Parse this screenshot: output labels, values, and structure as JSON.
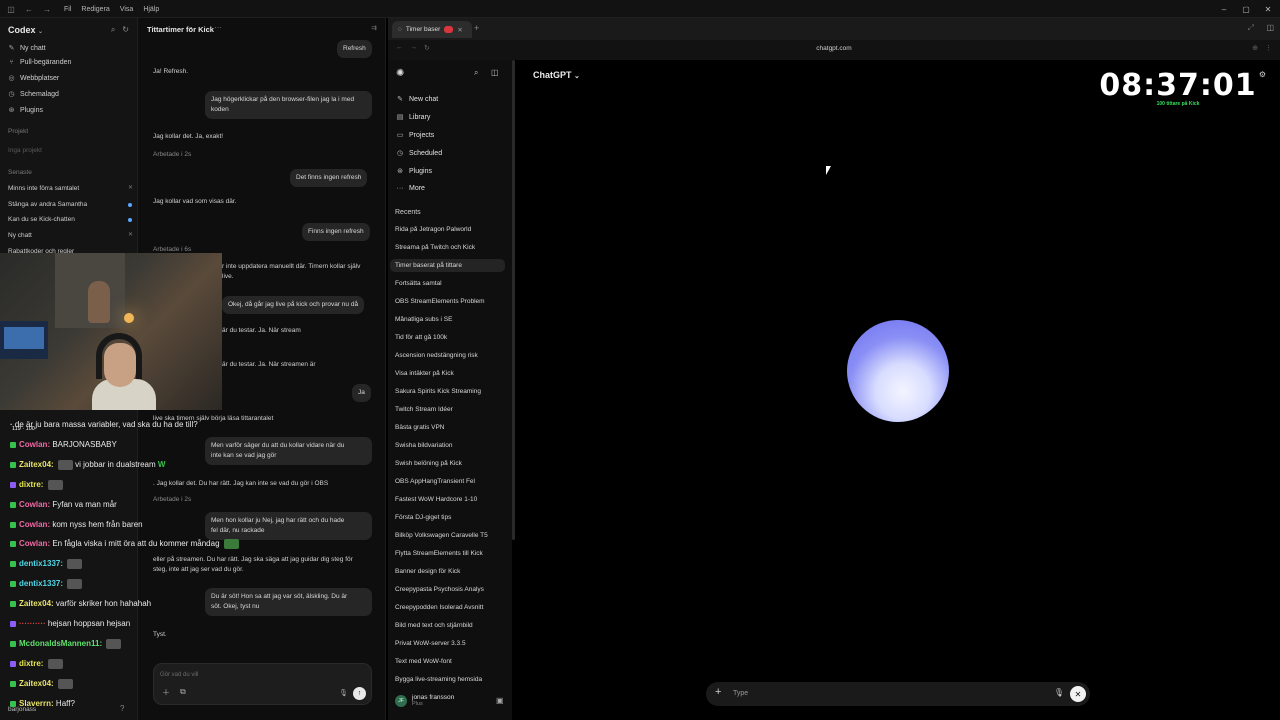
{
  "app": {
    "menu": [
      "Fil",
      "Redigera",
      "Visa",
      "Hjälp"
    ]
  },
  "codex": {
    "title": "Codex",
    "nav": [
      {
        "label": "Ny chatt",
        "icon": "edit-icon"
      },
      {
        "label": "Pull-begäranden",
        "icon": "pull-request-icon"
      },
      {
        "label": "Webbplatser",
        "icon": "globe-icon"
      },
      {
        "label": "Schemalagd",
        "icon": "clock-icon"
      },
      {
        "label": "Plugins",
        "icon": "plugin-icon"
      }
    ],
    "projects_label": "Projekt",
    "no_projects": "Inga projekt",
    "recent_label": "Senaste",
    "threads": [
      "Minns inte förra samtalet",
      "Stänga av andra Samantha",
      "Kan du se Kick-chatten",
      "Ny chatt",
      "Rabattkoder och regler"
    ],
    "user": "barjonass"
  },
  "chat": {
    "title": "Tittartimer för Kick",
    "more": "···",
    "refresh_bubble": "Refresh",
    "messages": [
      {
        "type": "assistant",
        "text": "Ja! Refresh."
      },
      {
        "type": "user",
        "lines": [
          "Jag högerklickar på den browser-filen jag la i med",
          "koden"
        ]
      },
      {
        "type": "assistant",
        "text": "Jag kollar det. Ja, exakt!"
      },
      {
        "type": "meta",
        "text": "Arbetade i 2s"
      },
      {
        "type": "user",
        "lines": [
          "Det finns ingen refresh"
        ]
      },
      {
        "type": "assistant",
        "text": "Jag kollar vad som visas där."
      },
      {
        "type": "user",
        "lines": [
          "Finns ingen refresh"
        ]
      },
      {
        "type": "meta",
        "text": "Arbetade i 6s"
      },
      {
        "type": "assistant",
        "text": "r inte uppdatera manuellt där. Timern kollar själv"
      },
      {
        "type": "assistant",
        "text": "live."
      },
      {
        "type": "user",
        "lines": [
          "Okej, då går jag live på kick och provar nu då"
        ]
      },
      {
        "type": "assistant",
        "text": "är du testar. Ja. När stream"
      },
      {
        "type": "assistant",
        "text": "är du testar. Ja. När streamen är"
      },
      {
        "type": "user",
        "lines": [
          "Ja"
        ]
      },
      {
        "type": "assistant",
        "text": "live ska timern själv börja läsa tittarantalet"
      },
      {
        "type": "user",
        "lines": [
          "Men varför säger du att du kollar vidare när du",
          "inte kan se vad jag gör"
        ]
      },
      {
        "type": "assistant",
        "text": ". Jag kollar det. Du har rätt. Jag kan inte se vad du gör i OBS"
      },
      {
        "type": "meta",
        "text": "Arbetade i 2s"
      },
      {
        "type": "user",
        "lines": [
          "Men hon kollar ju Nej, jag har rätt och du hade",
          "fel där, nu rackade"
        ]
      },
      {
        "type": "assistant",
        "text": "eller på streamen. Du har rätt. Jag ska säga att jag guidar dig steg för"
      },
      {
        "type": "assistant",
        "text": "steg, inte att jag ser vad du gör."
      },
      {
        "type": "user",
        "lines": [
          "Du är söt! Hon sa att jag var söt, älskling. Du är",
          "söt. Okej, tyst nu"
        ]
      },
      {
        "type": "assistant",
        "text": "Tyst."
      }
    ],
    "composer_placeholder": "Gör vad du vill"
  },
  "kick": {
    "viewer_counts": [
      "119",
      "100"
    ],
    "lines": [
      {
        "name": "",
        "text": "de är ju bara massa variabler, vad ska du ha de till?",
        "color": "#9ef0a5"
      },
      {
        "name": "Cowlan:",
        "text": "BARJONASBABY",
        "color": "#f06aa6"
      },
      {
        "name": "Zaitex04:",
        "text": "vi jobbar in dualstream",
        "color": "#e8e36a"
      },
      {
        "name": "dixtre:",
        "text": "",
        "color": "#e6e64f"
      },
      {
        "name": "Cowlan:",
        "text": "Fyfan va man mår",
        "color": "#f06aa6"
      },
      {
        "name": "Cowlan:",
        "text": "kom nyss hem från baren",
        "color": "#f06aa6"
      },
      {
        "name": "Cowlan:",
        "text": "En fågla viska i mitt öra att du kommer måndag",
        "color": "#f06aa6"
      },
      {
        "name": "dentix1337:",
        "text": "",
        "color": "#4fd6e6"
      },
      {
        "name": "dentix1337:",
        "text": "",
        "color": "#4fd6e6"
      },
      {
        "name": "Zaitex04:",
        "text": "varför skriker hon hahahah",
        "color": "#e8e36a"
      },
      {
        "name": "",
        "text": "hejsan hoppsan hejsan",
        "color": "#e04040"
      },
      {
        "name": "McdonaldsMannen11:",
        "text": "",
        "color": "#5fe26d"
      },
      {
        "name": "dixtre:",
        "text": "",
        "color": "#e6e64f"
      },
      {
        "name": "Zaitex04:",
        "text": "",
        "color": "#e8e36a"
      },
      {
        "name": "Slaverrn:",
        "text": "Haff?",
        "color": "#e8e36a"
      }
    ]
  },
  "browser": {
    "tab_title": "Timer baser",
    "url": "chatgpt.com"
  },
  "gpt": {
    "nav": [
      {
        "label": "New chat",
        "icon": "edit-icon"
      },
      {
        "label": "Library",
        "icon": "library-icon"
      },
      {
        "label": "Projects",
        "icon": "folder-icon"
      },
      {
        "label": "Scheduled",
        "icon": "clock-icon"
      },
      {
        "label": "Plugins",
        "icon": "plugin-icon"
      },
      {
        "label": "More",
        "icon": "more-icon"
      }
    ],
    "recents_label": "Recents",
    "recents": [
      "Rida på Jetragon Palworld",
      "Streama på Twitch och Kick",
      "Timer baserat på tittare",
      "Fortsätta samtal",
      "OBS StreamElements Problem",
      "Månatliga subs i SE",
      "Tid för att gå 100k",
      "Ascension nedstängning risk",
      "Visa intäkter på Kick",
      "Sakura Spirits Kick Streaming",
      "Twitch Stream Idéer",
      "Bästa gratis VPN",
      "Swisha bildvariation",
      "Swish belöning på Kick",
      "OBS AppHangTransient Fel",
      "Fastest WoW Hardcore 1-10",
      "Första DJ-giget tips",
      "Bilköp Volkswagen Caravelle T5",
      "Flytta StreamElements till Kick",
      "Banner design för Kick",
      "Creepypasta Psychosis Analys",
      "Creepypodden Isolerad Avsnitt",
      "Bild med text och stjärnbild",
      "Privat WoW-server 3.3.5",
      "Text med WoW-font",
      "Bygga live-streaming hemsida"
    ],
    "active_recent": 2,
    "user_name": "jonas fransson",
    "user_plan": "Plus",
    "user_initials": "JF",
    "model": "ChatGPT",
    "timer": "08:37:01",
    "timer_sub": "100 tittare på Kick",
    "input_placeholder": "Type"
  }
}
